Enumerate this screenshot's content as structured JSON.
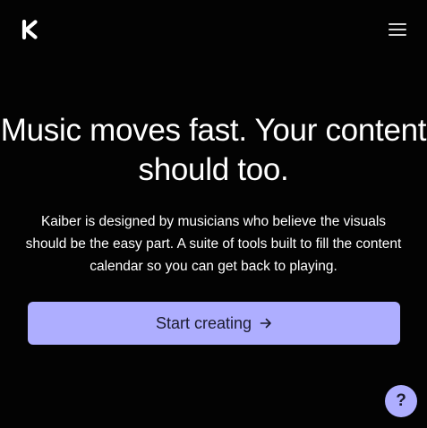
{
  "header": {
    "logo_icon": "kaiber-k-logo-icon",
    "menu_icon": "hamburger-menu-icon"
  },
  "hero": {
    "headline": "Music moves fast. Your content should too.",
    "description": "Kaiber is designed by musicians who believe the visuals should be the easy part. A suite of tools built to fill the content calendar so you can get back to playing.",
    "cta_label": "Start creating",
    "cta_icon": "arrow-right-icon",
    "accent_color": "#aeaeff"
  },
  "help_widget": {
    "label": "?"
  }
}
